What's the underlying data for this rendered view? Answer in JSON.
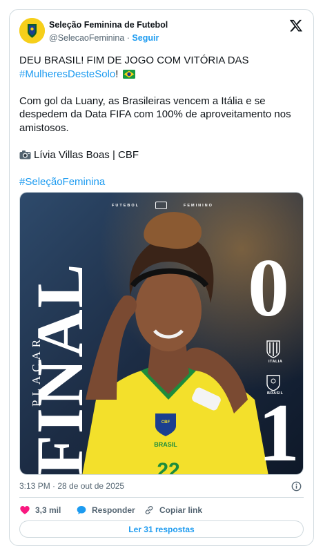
{
  "header": {
    "display_name": "Seleção Feminina de Futebol",
    "handle": "@SelecaoFeminina",
    "separator": "·",
    "follow_label": "Seguir",
    "avatar_text": "BRASIL"
  },
  "tweet": {
    "line1": "DEU BRASIL! FIM DE JOGO COM VITÓRIA DAS",
    "hashtag1": "#MulheresDesteSolo",
    "hashtag1_suffix": "!",
    "paragraph2": "Com gol da Luany, as Brasileiras vencem a Itália e se despedem da Data FIFA com 100% de aproveitamento nos amistosos.",
    "credit": "Lívia Villas Boas | CBF",
    "hashtag2": "#SeleçãoFeminina"
  },
  "media": {
    "top_left": "FUTEBOL",
    "top_right": "FEMININO",
    "placar_label": "PLACAR",
    "final_label": "FINAL",
    "score_italia": "0",
    "score_brasil": "1",
    "italia_label": "ITALIA",
    "brasil_label": "BRASIL",
    "shirt_text": "BRASIL",
    "shirt_number": "22"
  },
  "meta": {
    "timestamp": "3:13 PM · 28 de out de 2025"
  },
  "actions": {
    "likes": "3,3 mil",
    "reply_label": "Responder",
    "copy_label": "Copiar link"
  },
  "replies_button": "Ler 31 respostas",
  "colors": {
    "accent": "#1d9bf0",
    "like": "#f91880",
    "text": "#0f1419",
    "muted": "#536471",
    "jersey": "#f3e02b"
  }
}
